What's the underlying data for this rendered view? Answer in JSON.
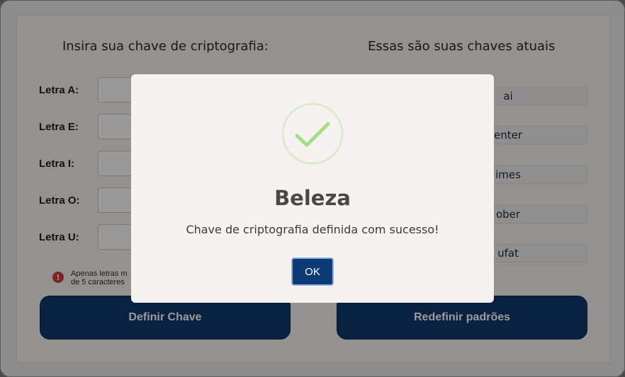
{
  "left": {
    "title": "Insira sua chave de criptografia:",
    "rows": [
      {
        "label": "Letra A:",
        "value": ""
      },
      {
        "label": "Letra E:",
        "value": ""
      },
      {
        "label": "Letra I:",
        "value": ""
      },
      {
        "label": "Letra O:",
        "value": ""
      },
      {
        "label": "Letra U:",
        "value": ""
      }
    ],
    "warning_line1": "Apenas letras m",
    "warning_line2": "de 5 caracteres",
    "define_button": "Definir Chave"
  },
  "right": {
    "title": "Essas são suas chaves atuais",
    "keys": [
      "ai",
      "enter",
      "imes",
      "ober",
      "ufat"
    ],
    "reset_button": "Redefinir padrões"
  },
  "modal": {
    "title": "Beleza",
    "message": "Chave de criptografia definida com sucesso!",
    "ok_button": "OK",
    "icon": "checkmark-icon",
    "accent_color": "#a5dc86"
  },
  "colors": {
    "primary_button": "#123a6d",
    "warning": "#d33a3a"
  }
}
